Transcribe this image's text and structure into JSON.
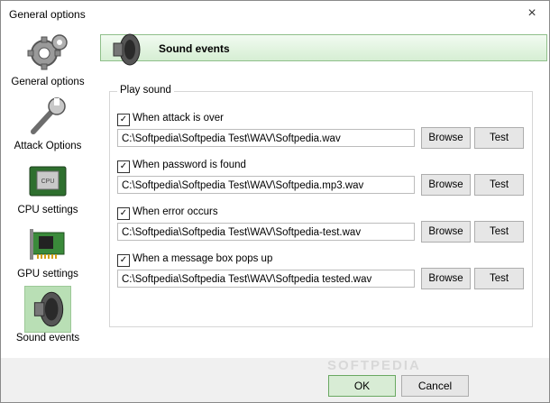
{
  "window": {
    "title": "General options",
    "close_glyph": "×"
  },
  "sidebar": {
    "items": [
      {
        "label": "General options",
        "icon": "gears-icon"
      },
      {
        "label": "Attack Options",
        "icon": "wrench-icon"
      },
      {
        "label": "CPU settings",
        "icon": "cpu-chip-icon"
      },
      {
        "label": "GPU settings",
        "icon": "gpu-card-icon"
      },
      {
        "label": "Sound events",
        "icon": "speaker-icon",
        "selected": true
      }
    ]
  },
  "header": {
    "title": "Sound events",
    "icon": "speaker-icon"
  },
  "group": {
    "title": "Play sound"
  },
  "events": [
    {
      "label": "When attack is over",
      "checked": true,
      "path": "C:\\Softpedia\\Softpedia Test\\WAV\\Softpedia.wav",
      "browse": "Browse",
      "test": "Test"
    },
    {
      "label": "When password is found",
      "checked": true,
      "path": "C:\\Softpedia\\Softpedia Test\\WAV\\Softpedia.mp3.wav",
      "browse": "Browse",
      "test": "Test"
    },
    {
      "label": "When error occurs",
      "checked": true,
      "path": "C:\\Softpedia\\Softpedia Test\\WAV\\Softpedia-test.wav",
      "browse": "Browse",
      "test": "Test"
    },
    {
      "label": "When a message box pops up",
      "checked": true,
      "path": "C:\\Softpedia\\Softpedia Test\\WAV\\Softpedia tested.wav",
      "browse": "Browse",
      "test": "Test"
    }
  ],
  "footer": {
    "ok": "OK",
    "cancel": "Cancel"
  },
  "watermark": "SOFTPEDIA",
  "colors": {
    "accent_green": "#d6eed3",
    "selected_bg": "#b9dfb5"
  }
}
